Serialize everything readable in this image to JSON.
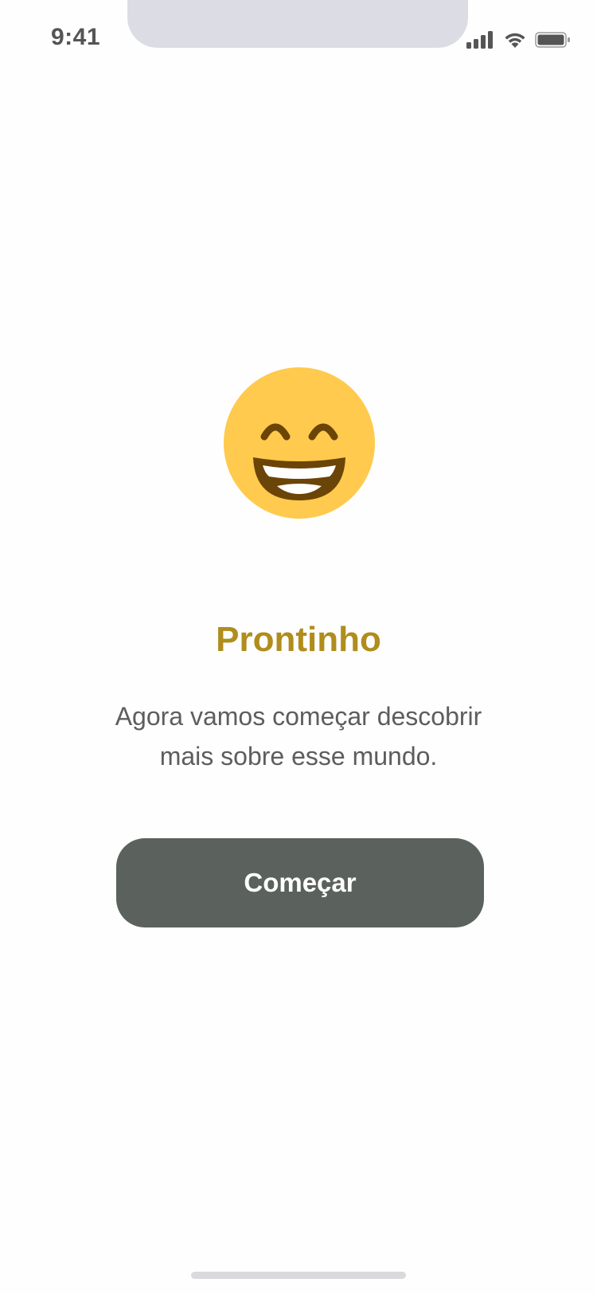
{
  "status_bar": {
    "time": "9:41",
    "icons": [
      "signal-icon",
      "wifi-icon",
      "battery-icon"
    ]
  },
  "content": {
    "emoji_icon": "grinning-face-with-smiling-eyes-icon",
    "title": "Prontinho",
    "subtitle_line1": "Agora vamos começar descobrir",
    "subtitle_line2": "mais sobre esse mundo.",
    "start_button_label": "Começar"
  },
  "colors": {
    "title": "#b08d1c",
    "subtitle": "#5d5d5d",
    "button_bg": "#5b625d",
    "button_text": "#ffffff",
    "emoji_face": "#ffca4d",
    "emoji_features": "#6b4407"
  }
}
